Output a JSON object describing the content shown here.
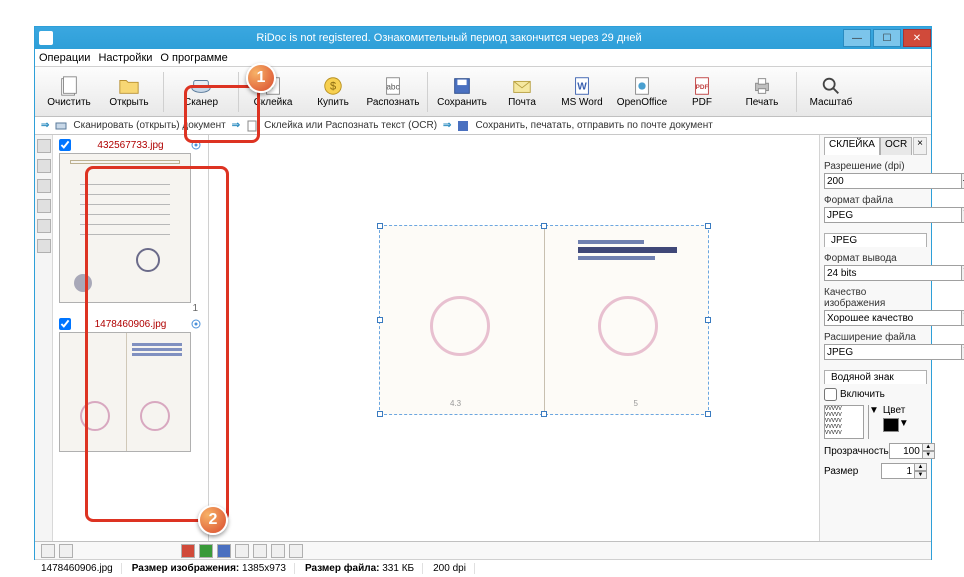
{
  "title": "RiDoc is not registered. Ознакомительный период закончится через 29 дней",
  "menu": {
    "operations": "Операции",
    "settings": "Настройки",
    "about": "О программе"
  },
  "toolbar": {
    "clear": "Очистить",
    "open": "Открыть",
    "scanner": "Сканер",
    "glue": "Склейка",
    "buy": "Купить",
    "recognize": "Распознать",
    "save": "Сохранить",
    "mail": "Почта",
    "msword": "MS Word",
    "openoffice": "OpenOffice",
    "pdf": "PDF",
    "print": "Печать",
    "zoom": "Масштаб"
  },
  "hints": {
    "h1": "Сканировать (открыть) документ",
    "h2": "Склейка или Распознать текст (OCR)",
    "h3": "Сохранить, печатать, отправить по почте документ"
  },
  "thumbs": [
    {
      "checked": true,
      "filename": "432567733.jpg",
      "page": "1"
    },
    {
      "checked": true,
      "filename": "1478460906.jpg",
      "page": ""
    }
  ],
  "preview": {
    "pageL": "4.3",
    "pageR": "5"
  },
  "right": {
    "tab_glue": "СКЛЕЙКА",
    "tab_ocr": "OCR",
    "res_label": "Разрешение (dpi)",
    "res_value": "200",
    "fmt_label": "Формат файла",
    "fmt_value": "JPEG",
    "jpeg_tab": "JPEG",
    "out_label": "Формат вывода",
    "out_value": "24 bits",
    "qual_label": "Качество изображения",
    "qual_value": "Хорошее качество",
    "ext_label": "Расширение файла",
    "ext_value": "JPEG",
    "wm_tab": "Водяной знак",
    "wm_enable": "Включить",
    "wm_color": "Цвет",
    "wm_opacity": "Прозрачность",
    "wm_opacity_v": "100",
    "wm_size": "Размер",
    "wm_size_v": "1"
  },
  "status": {
    "filename": "1478460906.jpg",
    "imgsize_label": "Размер изображения:",
    "imgsize": "1385x973",
    "filesize_label": "Размер файла:",
    "filesize": "331 КБ",
    "dpi": "200 dpi"
  },
  "callouts": {
    "c1": "1",
    "c2": "2"
  }
}
